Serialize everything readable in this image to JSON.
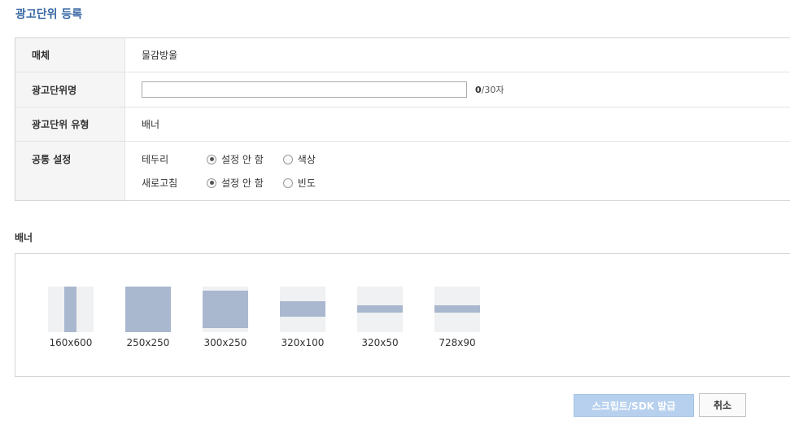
{
  "page": {
    "title": "광고단위 등록"
  },
  "form": {
    "media": {
      "label": "매체",
      "value": "물감방울"
    },
    "unit_name": {
      "label": "광고단위명",
      "value": "",
      "count": "0",
      "limit": "/30자"
    },
    "unit_type": {
      "label": "광고단위 유형",
      "value": "배너"
    },
    "common": {
      "label": "공통 설정",
      "border": {
        "label": "테두리",
        "options": [
          "설정 안 함",
          "색상"
        ],
        "selected": 0
      },
      "refresh": {
        "label": "새로고침",
        "options": [
          "설정 안 함",
          "빈도"
        ],
        "selected": 0
      }
    }
  },
  "banner": {
    "title": "배너",
    "sizes": [
      {
        "label": "160x600",
        "selected": false
      },
      {
        "label": "250x250",
        "selected": false
      },
      {
        "label": "300x250",
        "selected": false
      },
      {
        "label": "320x100",
        "selected": false
      },
      {
        "label": "320x50",
        "selected": false
      },
      {
        "label": "728x90",
        "selected": false
      }
    ]
  },
  "actions": {
    "issue": "스크립트/SDK 발급",
    "cancel": "취소"
  },
  "colors": {
    "accent": "#3c6aa6",
    "thumb_fill": "#aab8cf",
    "thumb_bg": "#f0f1f3",
    "issue_button": "#b7d0ee"
  }
}
